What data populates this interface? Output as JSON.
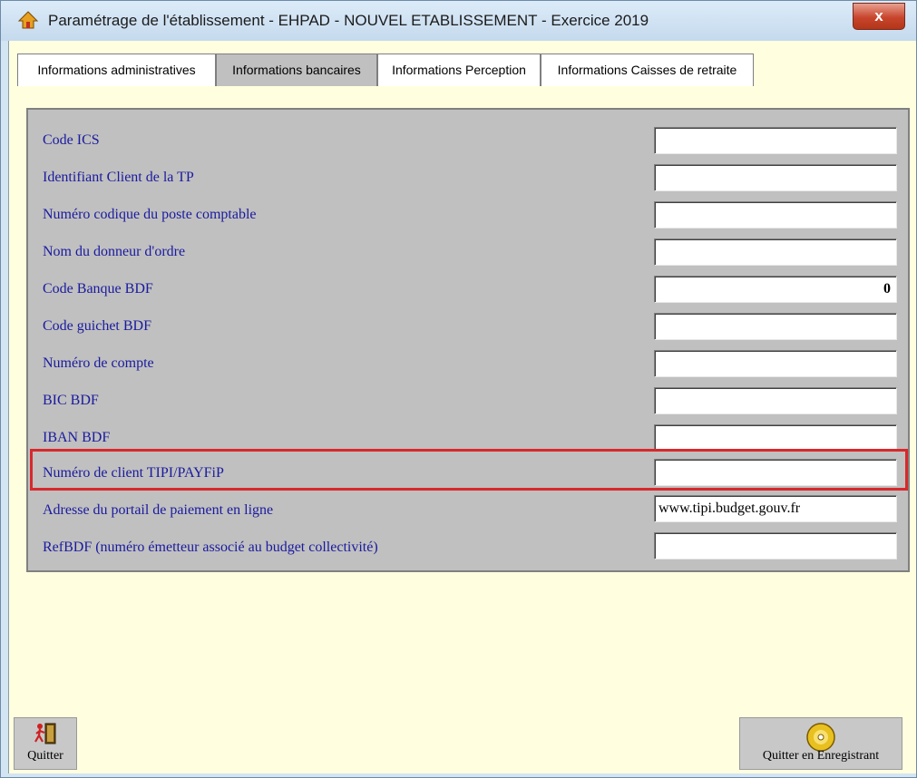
{
  "window": {
    "title": "Paramétrage de l'établissement - EHPAD  -  NOUVEL ETABLISSEMENT  -  Exercice  2019",
    "close_label": "x"
  },
  "tabs": [
    {
      "label": "Informations administratives",
      "active": false
    },
    {
      "label": "Informations bancaires",
      "active": true
    },
    {
      "label": "Informations Perception",
      "active": false
    },
    {
      "label": "Informations Caisses de retraite",
      "active": false
    }
  ],
  "fields": [
    {
      "label": "Code ICS",
      "value": ""
    },
    {
      "label": "Identifiant Client de la TP",
      "value": ""
    },
    {
      "label": "Numéro codique du poste comptable",
      "value": ""
    },
    {
      "label": "Nom du donneur d'ordre",
      "value": ""
    },
    {
      "label": "Code Banque BDF",
      "value": "0"
    },
    {
      "label": "Code guichet BDF",
      "value": ""
    },
    {
      "label": "Numéro de compte",
      "value": ""
    },
    {
      "label": "BIC BDF",
      "value": ""
    },
    {
      "label": "IBAN BDF",
      "value": ""
    },
    {
      "label": "Numéro de client TIPI/PAYFiP",
      "value": ""
    },
    {
      "label": "Adresse du portail de paiement en ligne",
      "value": "www.tipi.budget.gouv.fr"
    },
    {
      "label": "RefBDF (numéro émetteur associé au budget collectivité)",
      "value": ""
    }
  ],
  "buttons": {
    "quit_label": "Quitter",
    "quit_save_label": "Quitter en Enregistrant"
  },
  "colors": {
    "label_text": "#1a1aa0",
    "panel": "#c0c0c0",
    "background": "#ffffe0",
    "highlight": "#d8282c"
  }
}
